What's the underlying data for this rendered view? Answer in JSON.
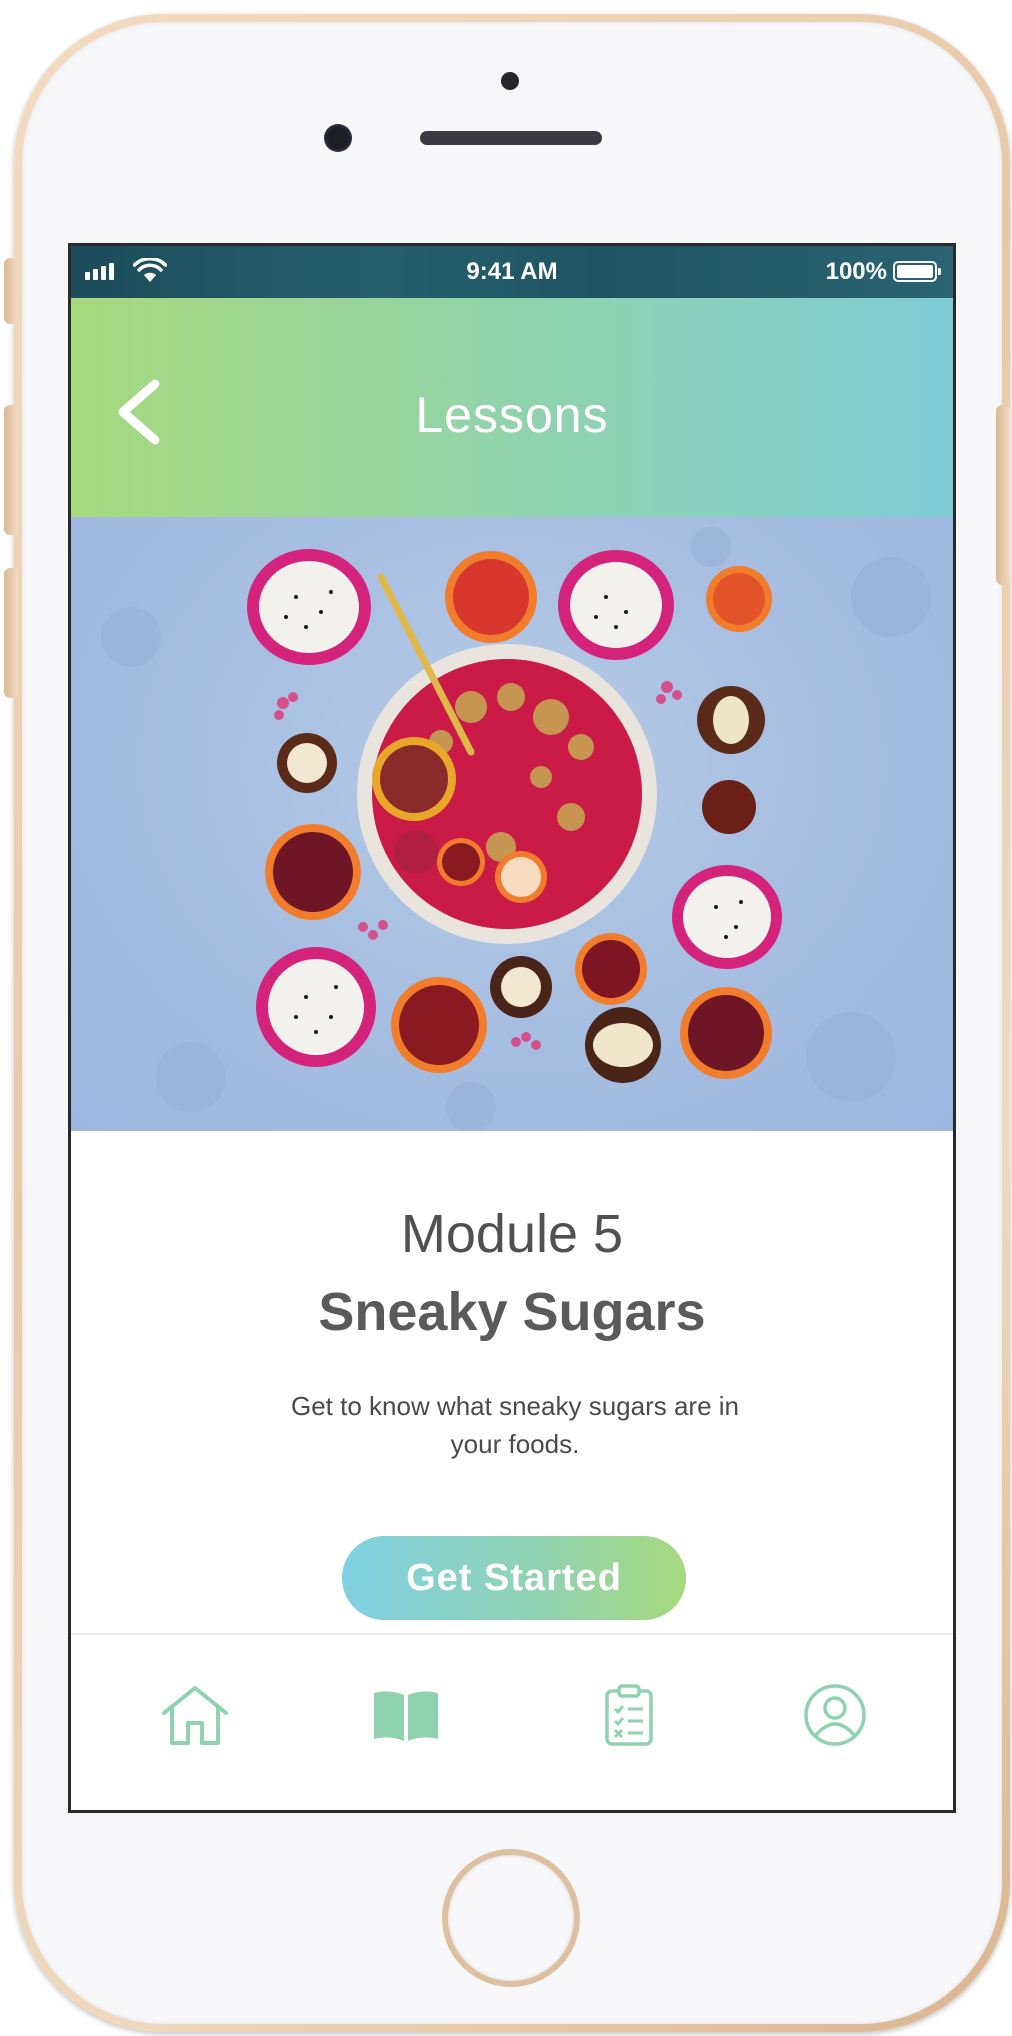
{
  "status_bar": {
    "time": "9:41 AM",
    "battery": "100%",
    "icons": [
      "signal-icon",
      "wifi-icon",
      "battery-icon"
    ]
  },
  "header": {
    "title": "Lessons",
    "back_icon": "chevron-left-icon"
  },
  "hero": {
    "image": "fruit-bowl-illustration"
  },
  "lesson": {
    "module": "Module 5",
    "title": "Sneaky Sugars",
    "description": "Get to know what sneaky sugars are in your foods."
  },
  "cta": {
    "label": "Get Started"
  },
  "tab_bar": {
    "tabs": [
      {
        "icon": "home-icon",
        "active": false
      },
      {
        "icon": "book-icon",
        "active": true
      },
      {
        "icon": "clipboard-checklist-icon",
        "active": false
      },
      {
        "icon": "profile-icon",
        "active": false
      }
    ]
  },
  "colors": {
    "header_gradient_start": "#a6d97d",
    "header_gradient_end": "#80cdd6",
    "tab_icon": "#8fd2b0",
    "text": "#555555"
  }
}
